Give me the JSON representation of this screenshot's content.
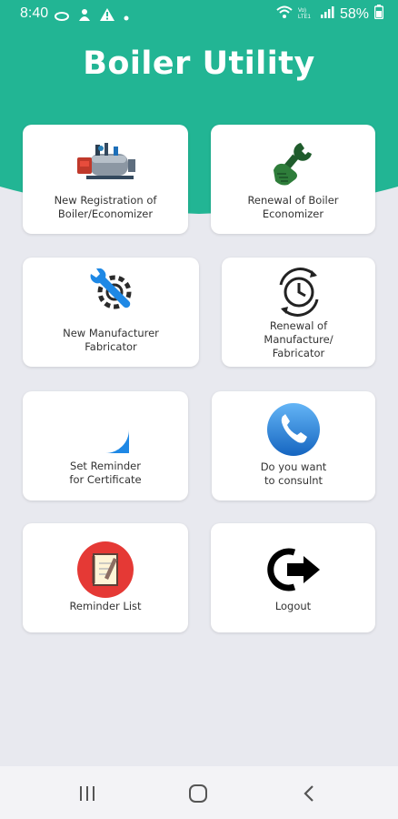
{
  "status_bar": {
    "time": "8:40",
    "network_label": "Vo) LTE1",
    "battery": "58%"
  },
  "app": {
    "title": "Boiler Utility"
  },
  "colors": {
    "accent": "#22b594",
    "background": "#e8e9ef"
  },
  "menu": [
    {
      "label": "New Registration of\nBoiler/Economizer",
      "icon": "boiler-icon"
    },
    {
      "label": "Renewal of Boiler\nEconomizer",
      "icon": "wrench-hand-icon"
    },
    {
      "label": "New Manufacturer\nFabricator",
      "icon": "gear-wrench-icon"
    },
    {
      "label": "Renewal of\nManufacture/\nFabricator",
      "icon": "clock-renew-icon"
    },
    {
      "label": "Set Reminder\nfor Certificate",
      "icon": "lightbulb-icon"
    },
    {
      "label": "Do you want\nto consulnt",
      "icon": "phone-icon"
    },
    {
      "label": "Reminder List",
      "icon": "notebook-icon"
    },
    {
      "label": "Logout",
      "icon": "logout-icon"
    }
  ]
}
